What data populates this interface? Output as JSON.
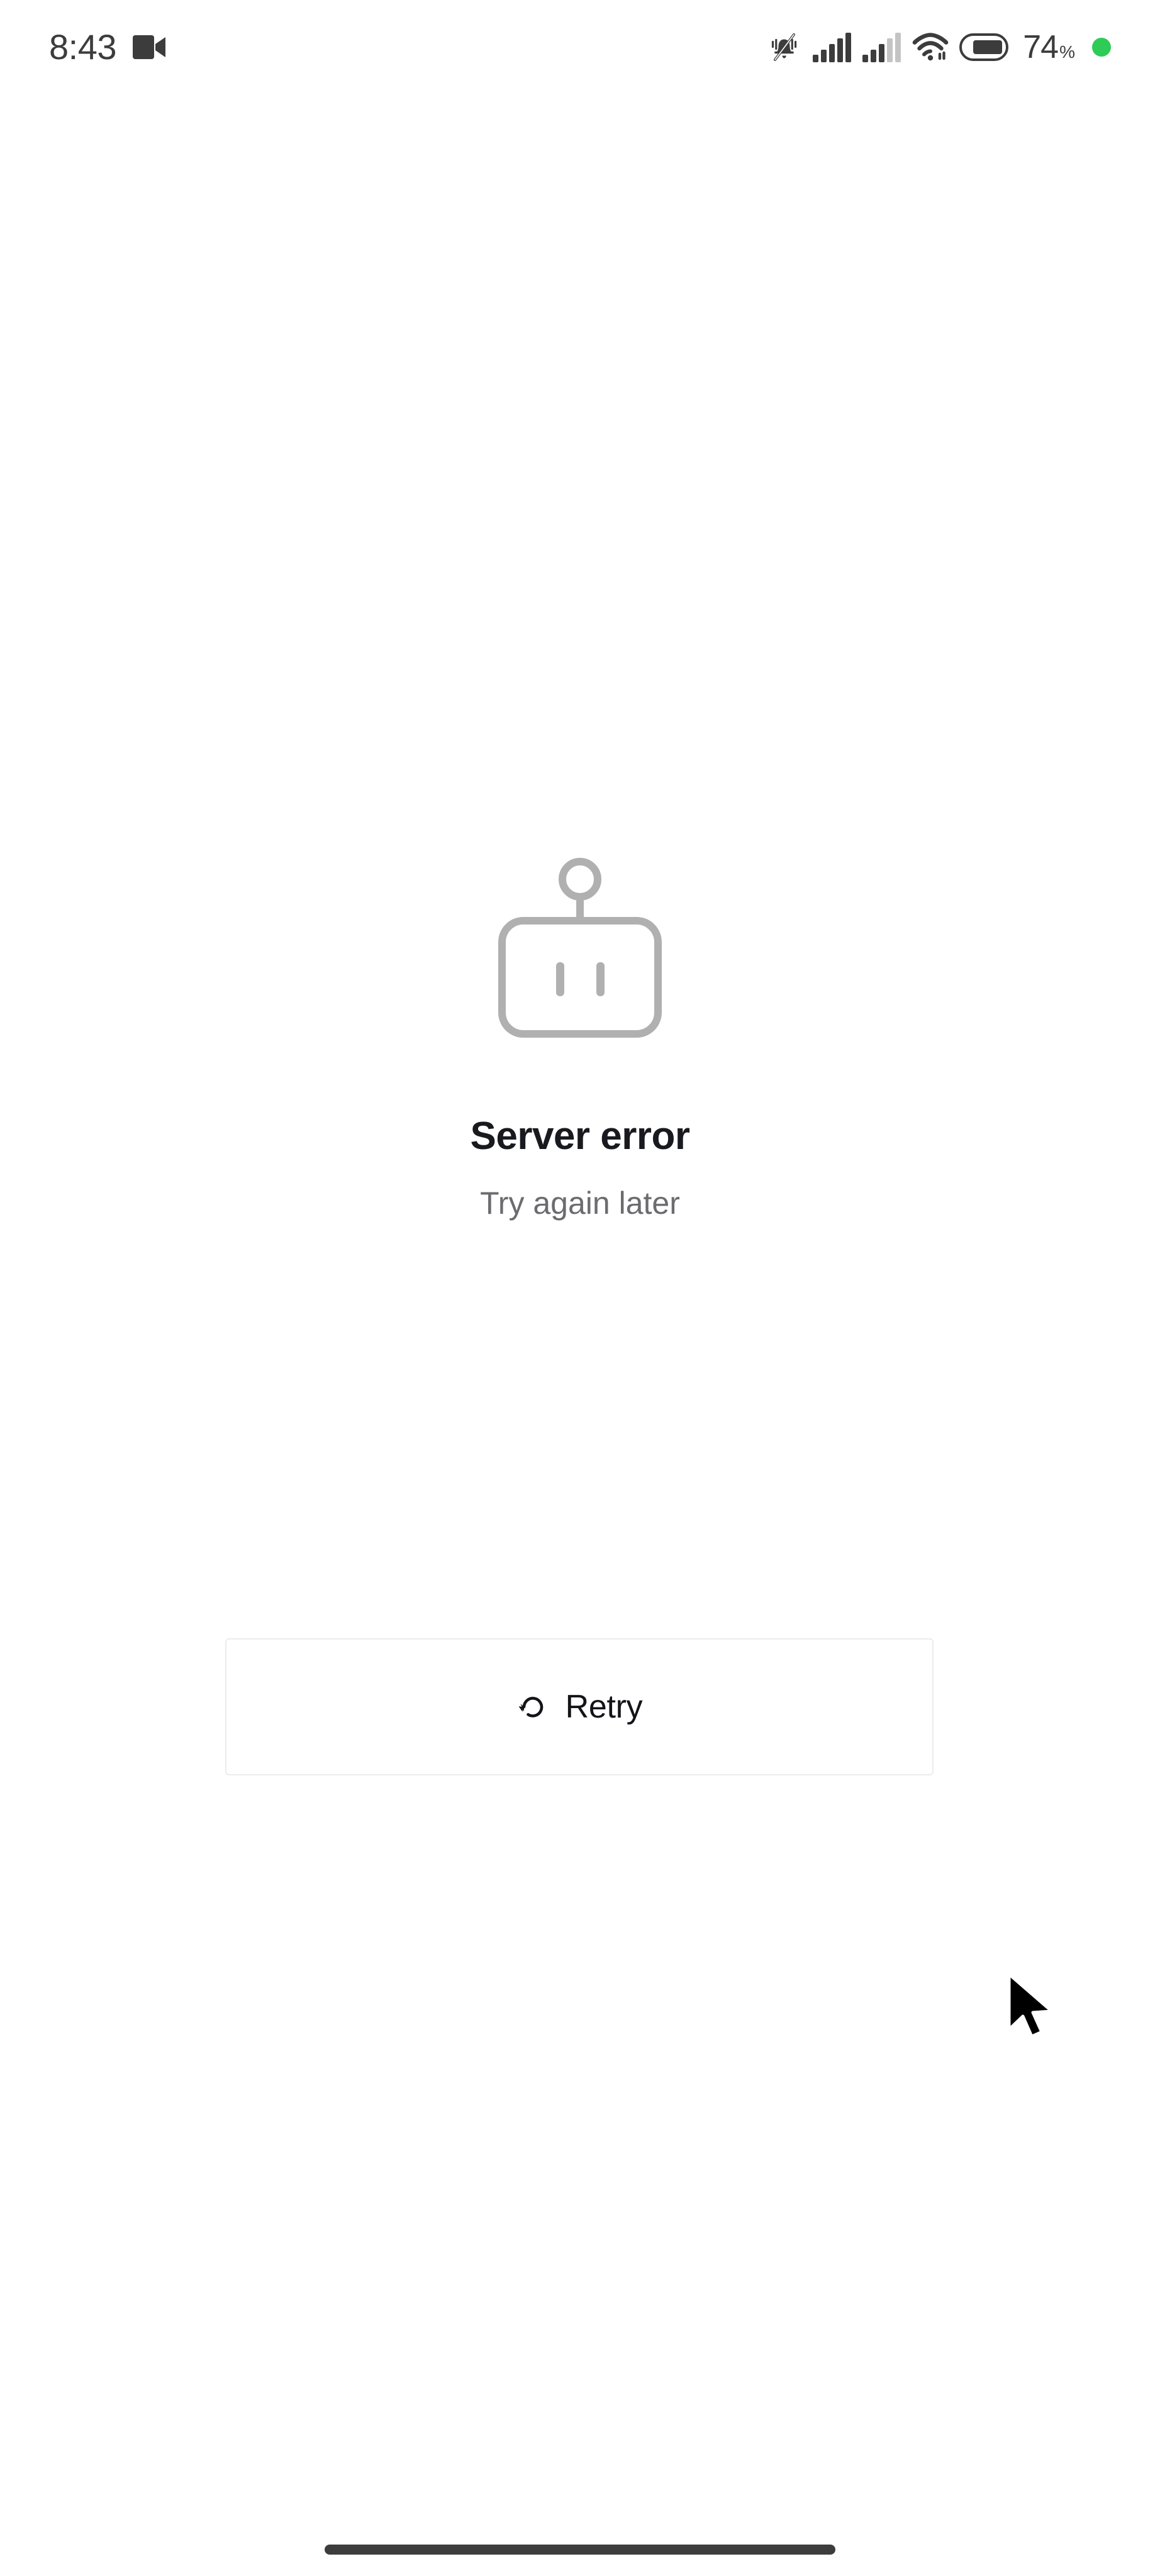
{
  "status_bar": {
    "clock": "8:43",
    "camera_icon": "video-camera-icon",
    "silent_icon": "bell-muted-icon",
    "signal_1_icon": "cellular-signal-full-icon",
    "signal_2_icon": "cellular-signal-partial-icon",
    "wifi_icon": "wifi-icon",
    "battery_icon": "battery-icon",
    "battery_level": "74",
    "battery_unit": "%",
    "indicator_dot": "green-status-dot",
    "colors": {
      "text": "#3c3c3c",
      "icon": "#3c3c3c",
      "icon_dim": "#c4c4c4",
      "dot_green": "#2ecc56"
    }
  },
  "error_state": {
    "illustration_icon": "robot-icon",
    "title": "Server error",
    "subtitle": "Try again later",
    "colors": {
      "illustration": "#b0b0b0",
      "title": "#191a1f",
      "subtitle": "#6b6b70"
    }
  },
  "retry_button": {
    "icon": "rotate-counter-clockwise-icon",
    "label": "Retry",
    "colors": {
      "border": "#ececec",
      "background": "#ffffff",
      "text": "#131318"
    }
  },
  "system_nav": {
    "home_indicator": "home-indicator-bar",
    "color": "#3d3d3d"
  },
  "pointer": {
    "cursor_icon": "mouse-arrow-cursor"
  }
}
